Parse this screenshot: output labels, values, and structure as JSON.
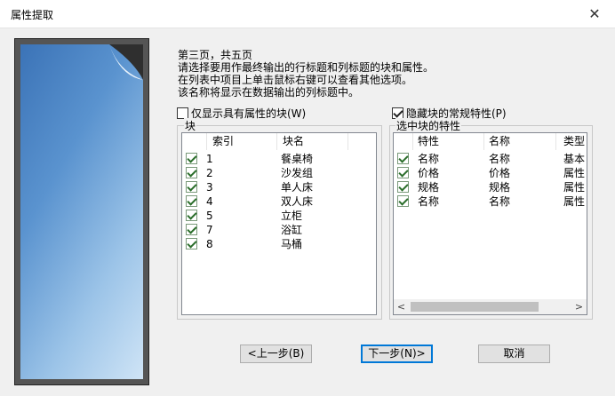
{
  "window": {
    "title": "属性提取",
    "close_glyph": "✕"
  },
  "instructions": [
    "第三页，共五页",
    "请选择要用作最终输出的行标题和列标题的块和属性。",
    "在列表中项目上单击鼠标右键可以查看其他选项。",
    "该名称将显示在数据输出的列标题中。"
  ],
  "options": {
    "only_with_attrs": {
      "label": "仅显示具有属性的块(W)",
      "checked": false
    },
    "hide_common": {
      "label": "隐藏块的常规特性(P)",
      "checked": true
    }
  },
  "blocks": {
    "group_label": "块",
    "columns": [
      "索引",
      "块名"
    ],
    "rows": [
      {
        "index": "1",
        "name": "餐桌椅",
        "checked": true
      },
      {
        "index": "2",
        "name": "沙发组",
        "checked": true
      },
      {
        "index": "3",
        "name": "单人床",
        "checked": true
      },
      {
        "index": "4",
        "name": "双人床",
        "checked": true
      },
      {
        "index": "5",
        "name": "立柜",
        "checked": true
      },
      {
        "index": "7",
        "name": "浴缸",
        "checked": true
      },
      {
        "index": "8",
        "name": "马桶",
        "checked": true
      }
    ]
  },
  "properties": {
    "group_label": "选中块的特性",
    "columns": [
      "特性",
      "名称",
      "类型"
    ],
    "rows": [
      {
        "prop": "名称",
        "name": "名称",
        "type": "基本",
        "checked": true
      },
      {
        "prop": "价格",
        "name": "价格",
        "type": "属性",
        "checked": true
      },
      {
        "prop": "规格",
        "name": "规格",
        "type": "属性",
        "checked": true
      },
      {
        "prop": "名称",
        "name": "名称",
        "type": "属性",
        "checked": true
      }
    ],
    "scroll_left": "<",
    "scroll_right": ">"
  },
  "buttons": {
    "back": "<上一步(B)",
    "next": "下一步(N)>",
    "cancel": "取消"
  }
}
